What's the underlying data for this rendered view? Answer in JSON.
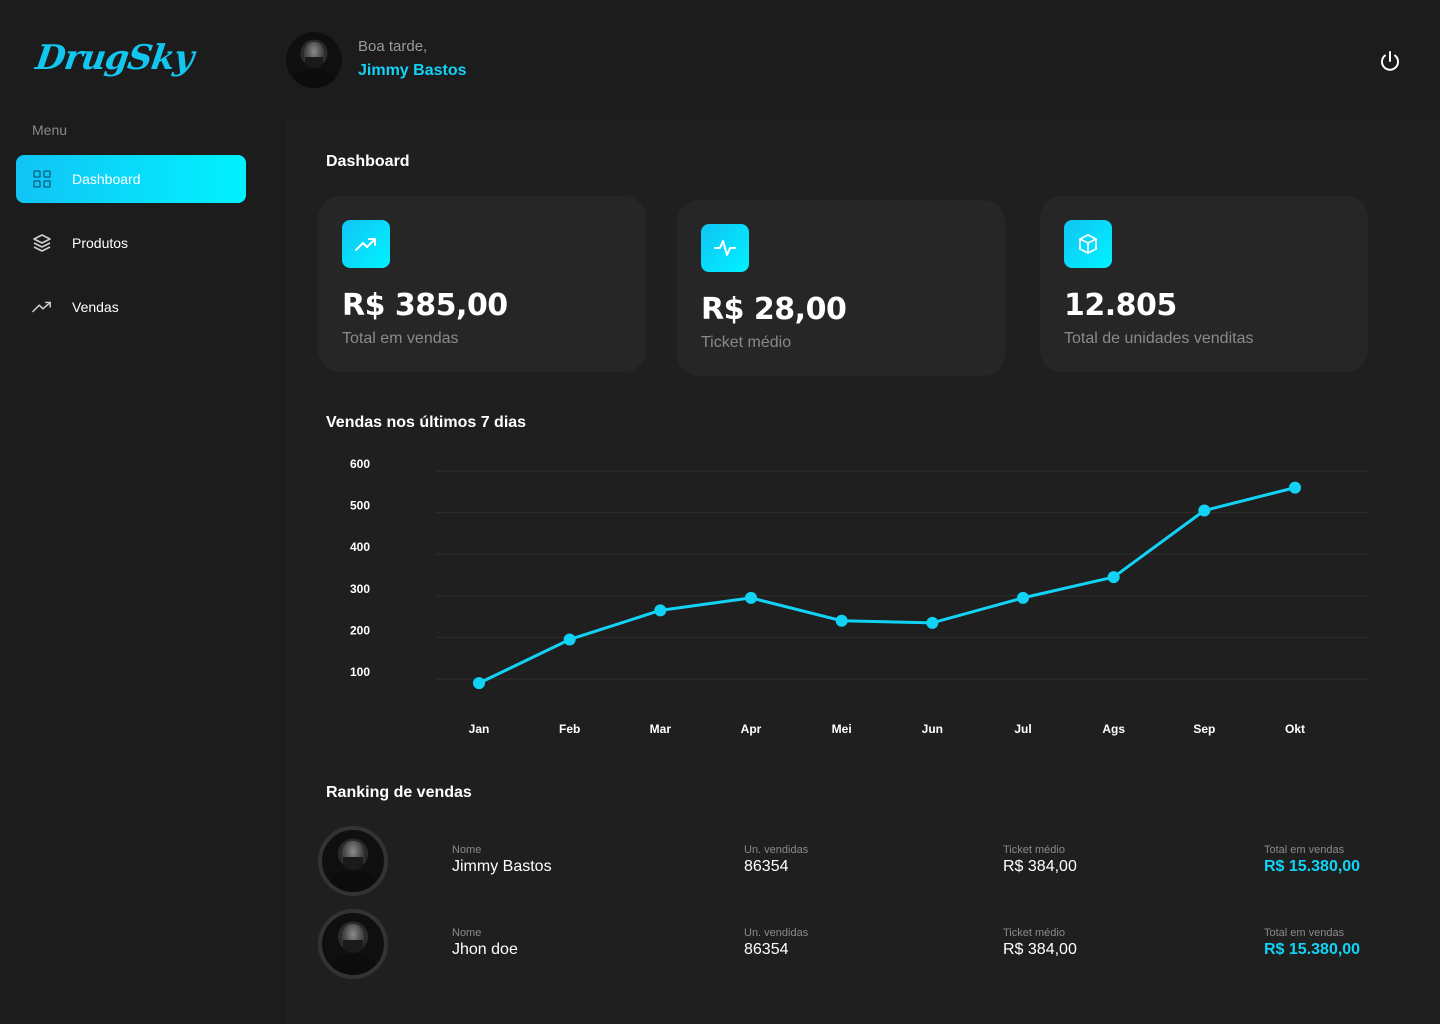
{
  "brand": {
    "name": "DrugSky"
  },
  "sidebar": {
    "menu_label": "Menu",
    "items": [
      {
        "label": "Dashboard",
        "icon": "grid-icon",
        "active": true
      },
      {
        "label": "Produtos",
        "icon": "layers-icon",
        "active": false
      },
      {
        "label": "Vendas",
        "icon": "trending-up-icon",
        "active": false
      }
    ]
  },
  "header": {
    "greeting": "Boa tarde,",
    "user_name": "Jimmy Bastos",
    "power_icon": "power-icon"
  },
  "dashboard": {
    "title": "Dashboard",
    "cards": [
      {
        "value": "R$ 385,00",
        "caption": "Total em vendas",
        "icon": "trending-up-icon"
      },
      {
        "value": "R$ 28,00",
        "caption": "Ticket médio",
        "icon": "activity-icon"
      },
      {
        "value": "12.805",
        "caption": "Total de unidades venditas",
        "icon": "box-icon"
      }
    ]
  },
  "chart_section": {
    "title": "Vendas nos últimos 7 dias"
  },
  "chart_data": {
    "type": "line",
    "categories": [
      "Jan",
      "Feb",
      "Mar",
      "Apr",
      "Mei",
      "Jun",
      "Jul",
      "Ags",
      "Sep",
      "Okt"
    ],
    "series": [
      {
        "values": [
          90,
          195,
          265,
          295,
          240,
          235,
          295,
          345,
          505,
          560
        ]
      }
    ],
    "yticks": [
      100,
      200,
      300,
      400,
      500,
      600
    ],
    "ylim": [
      100,
      600
    ],
    "grid": true,
    "color": "#12d3f5"
  },
  "ranking": {
    "title": "Ranking de vendas",
    "labels": {
      "name": "Nome",
      "units": "Un. vendidas",
      "ticket": "Ticket médio",
      "total": "Total em vendas"
    },
    "rows": [
      {
        "name": "Jimmy Bastos",
        "units": "86354",
        "ticket": "R$ 384,00",
        "total": "R$ 15.380,00"
      },
      {
        "name": "Jhon doe",
        "units": "86354",
        "ticket": "R$ 384,00",
        "total": "R$ 15.380,00"
      }
    ]
  },
  "colors": {
    "accent": "#12d3f5",
    "background": "#1c1c1c",
    "card": "#262626"
  }
}
